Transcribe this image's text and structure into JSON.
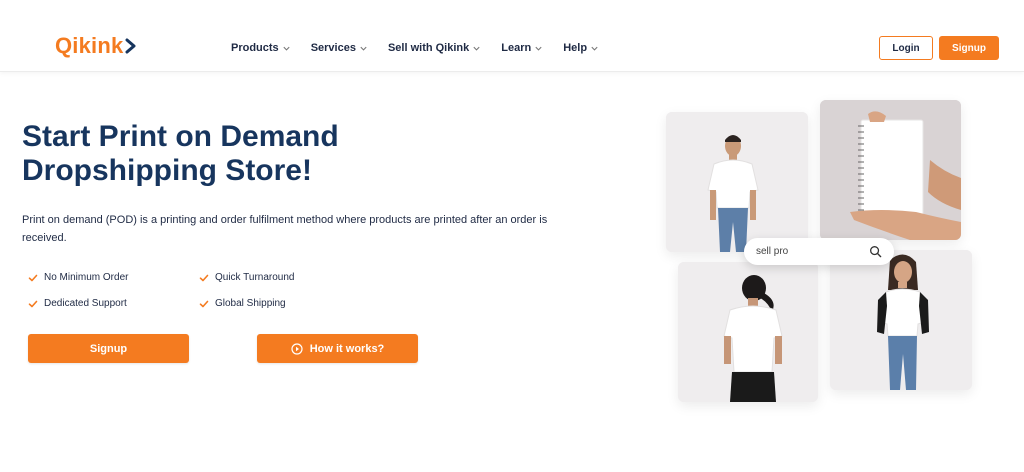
{
  "brand": {
    "logo_text": "Qikink",
    "logo_color": "#f47b20"
  },
  "nav": {
    "items": [
      {
        "label": "Products"
      },
      {
        "label": "Services"
      },
      {
        "label": "Sell with Qikink"
      },
      {
        "label": "Learn"
      },
      {
        "label": "Help"
      }
    ],
    "login_label": "Login",
    "signup_label": "Signup"
  },
  "hero": {
    "title_line1": "Start Print on Demand",
    "title_line2": "Dropshipping Store!",
    "description": "Print on demand (POD) is a printing and order fulfilment method where products are printed after an order is received.",
    "features": [
      {
        "label": "No Minimum Order"
      },
      {
        "label": "Quick Turnaround"
      },
      {
        "label": "Dedicated Support"
      },
      {
        "label": "Global Shipping"
      }
    ],
    "signup_label": "Signup",
    "how_it_works_label": "How it works?"
  },
  "collage": {
    "search_text": "sell pro",
    "search_icon": "search-icon"
  },
  "colors": {
    "accent": "#f47b20",
    "title": "#17355e",
    "text": "#1f2a44"
  }
}
